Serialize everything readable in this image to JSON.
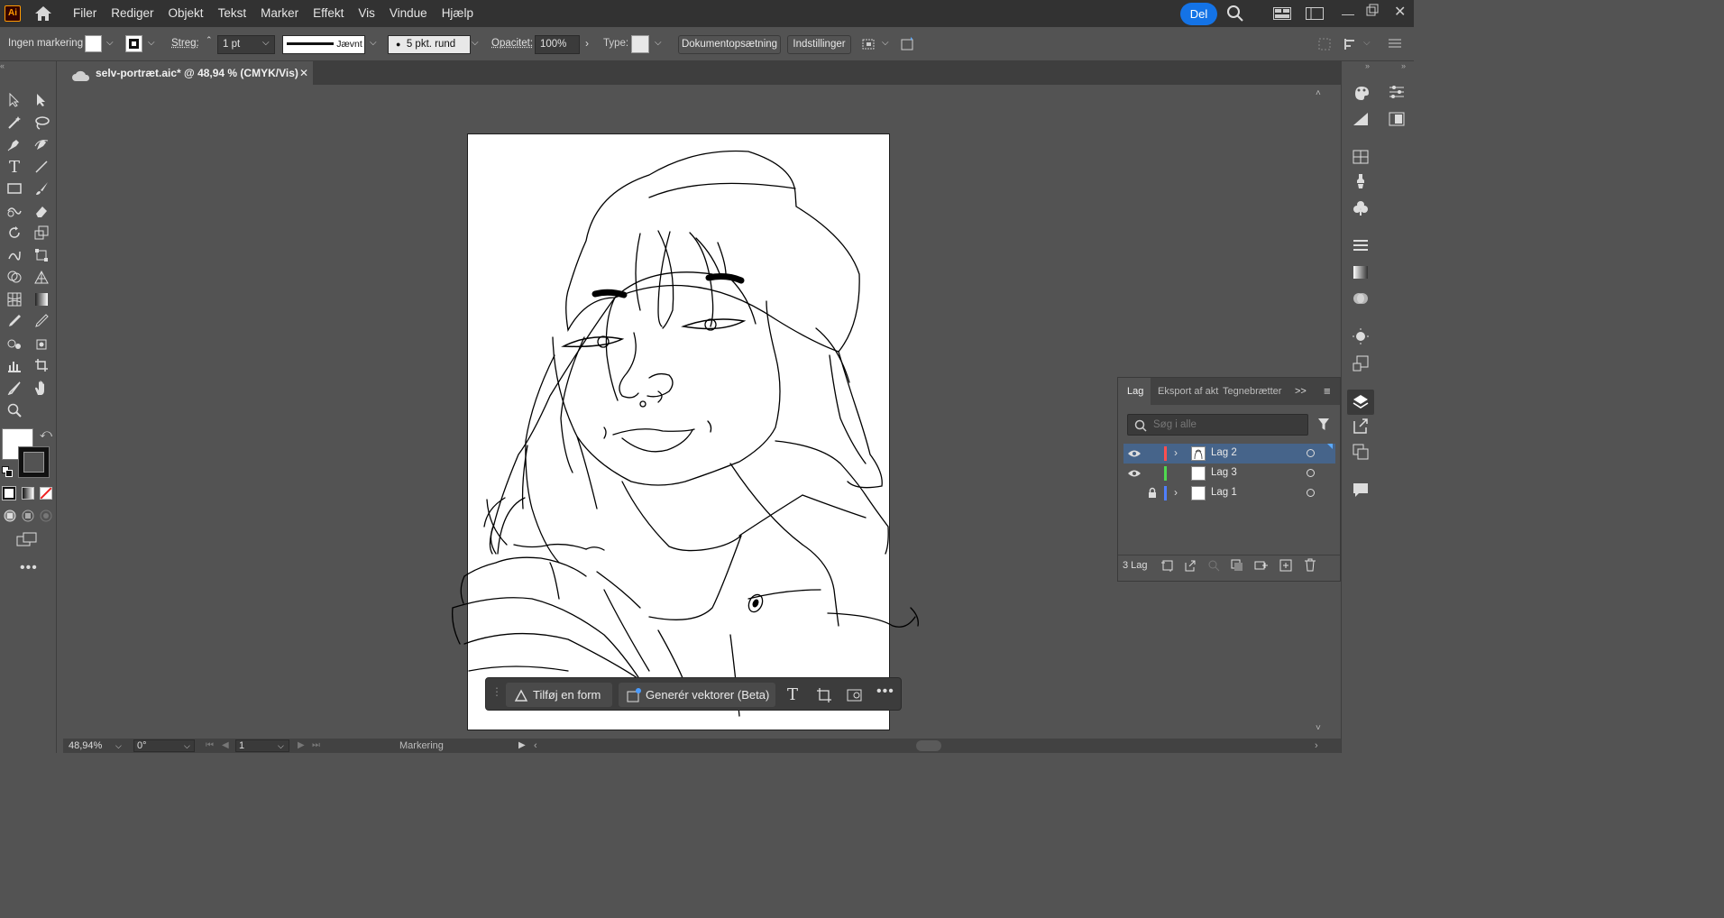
{
  "app": {
    "logo": "Ai"
  },
  "menu": [
    "Filer",
    "Rediger",
    "Objekt",
    "Tekst",
    "Marker",
    "Effekt",
    "Vis",
    "Vindue",
    "Hjælp"
  ],
  "share_label": "Del",
  "control": {
    "selection": "Ingen markering",
    "stroke_label": "Streg:",
    "stroke_weight": "1 pt",
    "stroke_profile": "Jævnt",
    "brush": "5 pkt. rund",
    "opacity_label": "Opacitet:",
    "opacity_value": "100%",
    "type_label": "Type:",
    "doc_setup": "Dokumentopsætning",
    "preferences": "Indstillinger"
  },
  "document_tab": {
    "title": "selv-portræt.aic* @ 48,94 % (CMYK/Vis)"
  },
  "layers_panel": {
    "tabs": [
      "Lag",
      "Eksport af akt",
      "Tegnebrætter"
    ],
    "search_placeholder": "Søg i alle",
    "layers": [
      {
        "name": "Lag 2",
        "color": "#ff4f4f",
        "visible": true,
        "locked": false,
        "expandable": true,
        "selected": true
      },
      {
        "name": "Lag 3",
        "color": "#4fd94f",
        "visible": true,
        "locked": false,
        "expandable": false,
        "selected": false
      },
      {
        "name": "Lag 1",
        "color": "#4f7fff",
        "visible": false,
        "locked": true,
        "expandable": true,
        "selected": false
      }
    ],
    "count": "3 Lag"
  },
  "context_bar": {
    "add_shape": "Tilføj en form",
    "generate_vectors": "Generér vektorer (Beta)"
  },
  "status": {
    "zoom": "48,94%",
    "rotation": "0°",
    "artboard": "1",
    "mode": "Markering"
  }
}
